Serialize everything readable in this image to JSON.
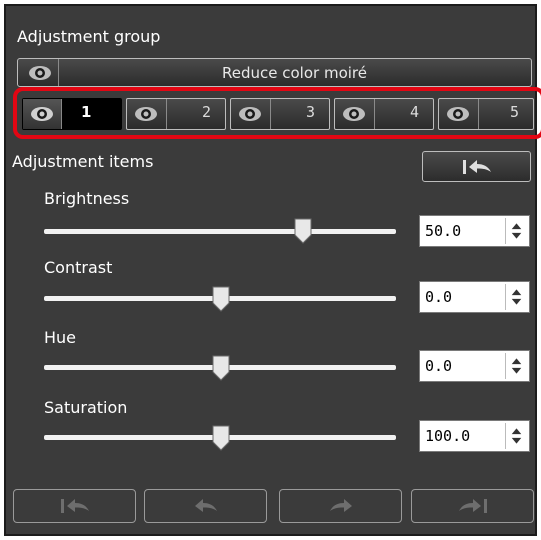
{
  "panel": {
    "group_heading": "Adjustment group",
    "moire_button_label": "Reduce color moiré",
    "groups": [
      {
        "label": "1",
        "active": true
      },
      {
        "label": "2",
        "active": false
      },
      {
        "label": "3",
        "active": false
      },
      {
        "label": "4",
        "active": false
      },
      {
        "label": "5",
        "active": false
      }
    ],
    "items_heading": "Adjustment items",
    "sliders": [
      {
        "label": "Brightness",
        "value": "50.0",
        "slider_fraction": 0.75
      },
      {
        "label": "Contrast",
        "value": "0.0",
        "slider_fraction": 0.5
      },
      {
        "label": "Hue",
        "value": "0.0",
        "slider_fraction": 0.5
      },
      {
        "label": "Saturation",
        "value": "100.0",
        "slider_fraction": 0.5
      }
    ]
  },
  "icons": {
    "reset": "reset-to-start-icon",
    "undo": "undo-icon",
    "redo": "redo-icon",
    "redo_all": "redo-to-end-icon",
    "eye": "eye-icon",
    "spinner": "spinner-arrows-icon"
  },
  "colors": {
    "panel_bg": "#3b3b3b",
    "highlight_ring": "#e30613",
    "active_group_bg": "#000000"
  }
}
